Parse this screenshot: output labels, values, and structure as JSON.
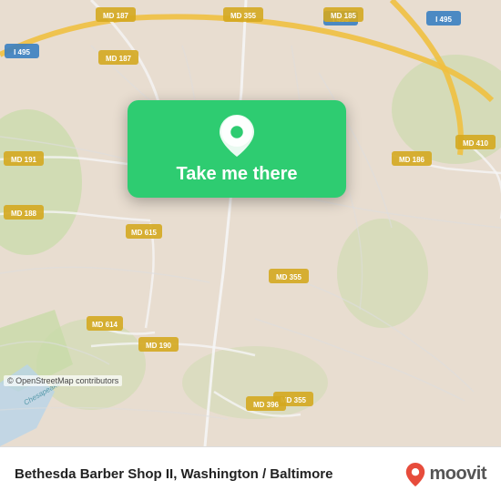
{
  "map": {
    "background_color": "#e8e0d5"
  },
  "popup": {
    "label": "Take me there",
    "bg_color": "#2ecc71"
  },
  "bottom_bar": {
    "place_name": "Bethesda Barber Shop II, Washington / Baltimore",
    "moovit_text": "moovit",
    "attribution": "© OpenStreetMap contributors"
  },
  "road_labels": [
    "I 495",
    "I 495",
    "I 495",
    "MD 187",
    "MD 187",
    "MD 355",
    "MD 355",
    "MD 355",
    "MD 185",
    "MD 191",
    "MD 188",
    "MD 186",
    "MD 410",
    "MD 615",
    "MD 614",
    "MD 190",
    "MD 396"
  ]
}
